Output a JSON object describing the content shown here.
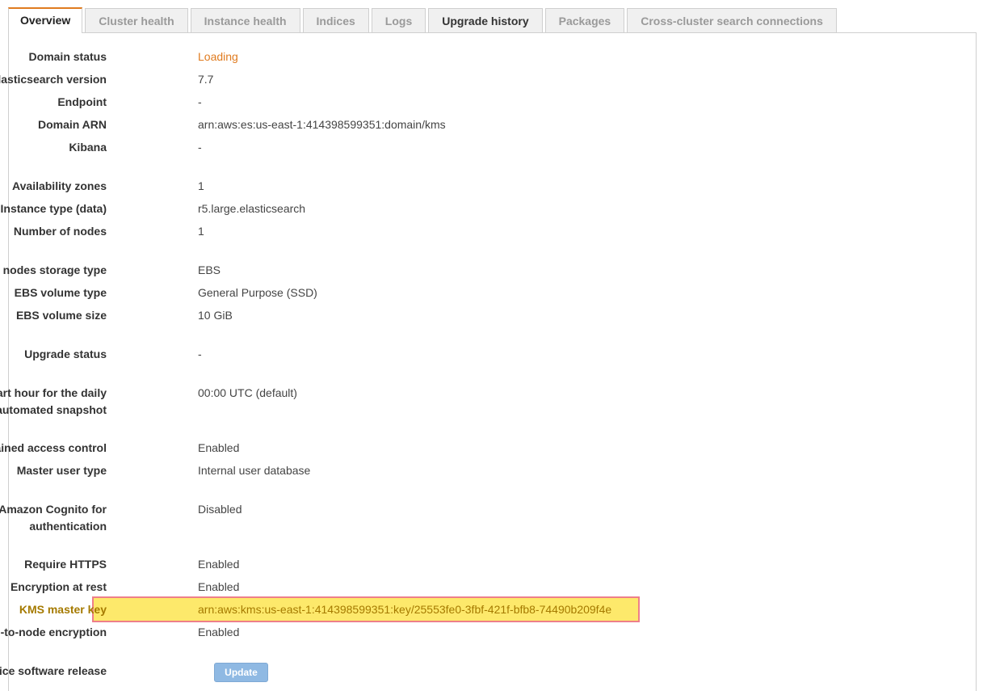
{
  "tabs": [
    {
      "label": "Overview",
      "state": "active"
    },
    {
      "label": "Cluster health",
      "state": "disabled"
    },
    {
      "label": "Instance health",
      "state": "disabled"
    },
    {
      "label": "Indices",
      "state": "disabled"
    },
    {
      "label": "Logs",
      "state": "disabled"
    },
    {
      "label": "Upgrade history",
      "state": "enabled"
    },
    {
      "label": "Packages",
      "state": "disabled"
    },
    {
      "label": "Cross-cluster search connections",
      "state": "disabled"
    }
  ],
  "fields": {
    "domain_status": {
      "label": "Domain status",
      "value": "Loading"
    },
    "es_version": {
      "label": "Elasticsearch version",
      "value": "7.7"
    },
    "endpoint": {
      "label": "Endpoint",
      "value": "-"
    },
    "domain_arn": {
      "label": "Domain ARN",
      "value": "arn:aws:es:us-east-1:414398599351:domain/kms"
    },
    "kibana": {
      "label": "Kibana",
      "value": "-"
    },
    "availability_zones": {
      "label": "Availability zones",
      "value": "1"
    },
    "instance_type": {
      "label": "Instance type (data)",
      "value": "r5.large.elasticsearch"
    },
    "number_of_nodes": {
      "label": "Number of nodes",
      "value": "1"
    },
    "storage_type": {
      "label": "Data nodes storage type",
      "value": "EBS"
    },
    "ebs_volume_type": {
      "label": "EBS volume type",
      "value": "General Purpose (SSD)"
    },
    "ebs_volume_size": {
      "label": "EBS volume size",
      "value": "10 GiB"
    },
    "upgrade_status": {
      "label": "Upgrade status",
      "value": "-"
    },
    "snapshot_hour": {
      "label_line1": "Start hour for the daily",
      "label_line2": "automated snapshot",
      "value": "00:00 UTC (default)"
    },
    "fgac": {
      "label": "Fine-grained access control",
      "value": "Enabled"
    },
    "master_user_type": {
      "label": "Master user type",
      "value": "Internal user database"
    },
    "cognito": {
      "label_line1": "Amazon Cognito for",
      "label_line2": "authentication",
      "value": "Disabled"
    },
    "require_https": {
      "label": "Require HTTPS",
      "value": "Enabled"
    },
    "encryption_at_rest": {
      "label": "Encryption at rest",
      "value": "Enabled"
    },
    "kms_master_key": {
      "label": "KMS master key",
      "value": "arn:aws:kms:us-east-1:414398599351:key/25553fe0-3fbf-421f-bfb8-74490b209f4e"
    },
    "node_to_node": {
      "label": "Node-to-node encryption",
      "value": "Enabled"
    },
    "service_software": {
      "label": "Service software release",
      "button_label": "Update"
    }
  },
  "colors": {
    "accent": "#e07b1f",
    "highlight_fill": "#fde96b",
    "highlight_border": "#ee7f8a",
    "button_fill": "#8fb9e3"
  }
}
